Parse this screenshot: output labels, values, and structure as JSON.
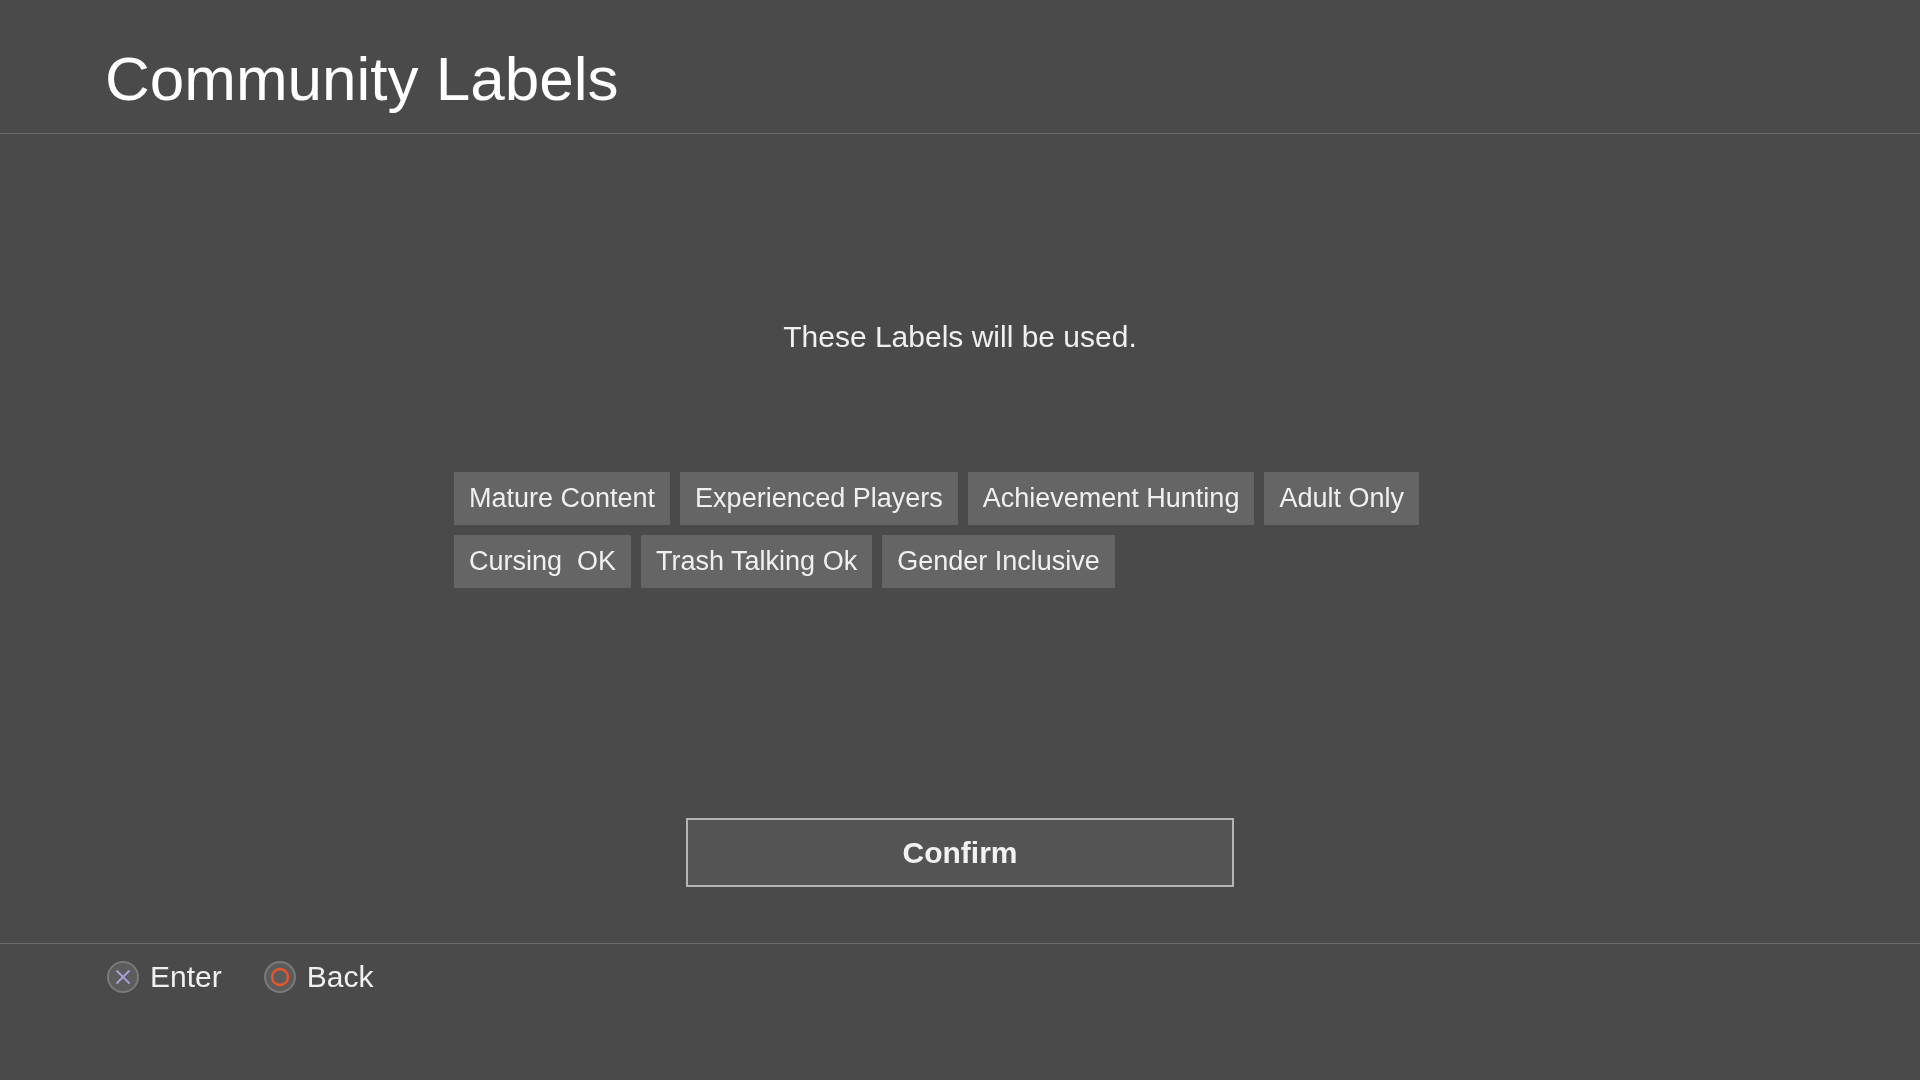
{
  "header": {
    "title": "Community Labels"
  },
  "message": "These Labels will be used.",
  "label_rows": [
    [
      "Mature Content",
      "Experienced Players",
      "Achievement Hunting",
      "Adult Only"
    ],
    [
      "Cursing  OK",
      "Trash Talking Ok",
      "Gender Inclusive"
    ]
  ],
  "confirm_button": {
    "label": "Confirm"
  },
  "footer_hints": [
    {
      "kind": "cross",
      "label": "Enter"
    },
    {
      "kind": "circle",
      "label": "Back"
    }
  ]
}
